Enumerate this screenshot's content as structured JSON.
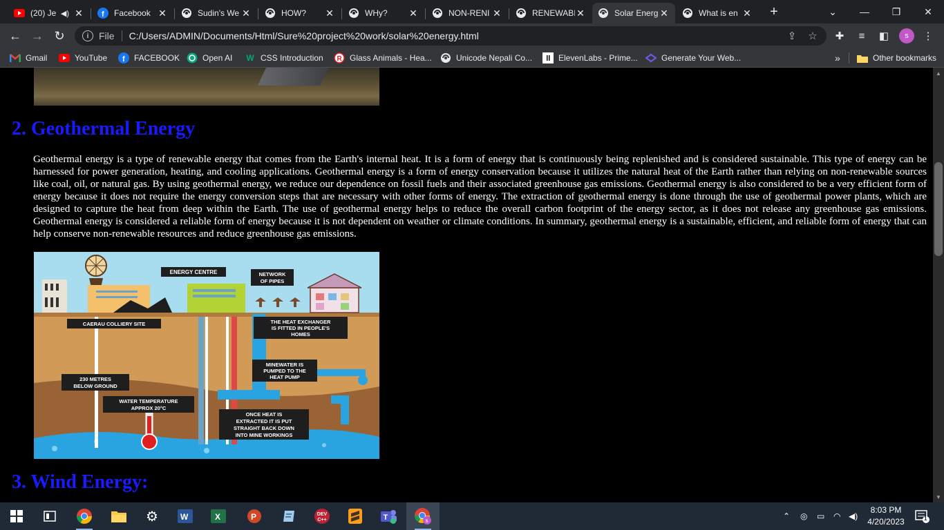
{
  "tabs": [
    {
      "title": "(20) Je",
      "icon": "youtube-icon",
      "audio": true
    },
    {
      "title": "Facebook",
      "icon": "facebook-icon"
    },
    {
      "title": "Sudin's We",
      "icon": "globe-icon"
    },
    {
      "title": "HOW?",
      "icon": "globe-icon"
    },
    {
      "title": "WHy?",
      "icon": "globe-icon"
    },
    {
      "title": "NON-RENI",
      "icon": "globe-icon"
    },
    {
      "title": "RENEWABI",
      "icon": "globe-icon"
    },
    {
      "title": "Solar Energ",
      "icon": "globe-icon",
      "active": true
    },
    {
      "title": "What is en",
      "icon": "globe-icon"
    }
  ],
  "toolbar": {
    "file_label": "File",
    "url": "C:/Users/ADMIN/Documents/Html/Sure%20project%20work/solar%20energy.html",
    "profile_initial": "s"
  },
  "bookmarks": [
    {
      "label": "Gmail",
      "icon": "gmail-icon"
    },
    {
      "label": "YouTube",
      "icon": "youtube-icon"
    },
    {
      "label": "FACEBOOK",
      "icon": "facebook-icon"
    },
    {
      "label": "Open AI",
      "icon": "openai-icon"
    },
    {
      "label": "CSS Introduction",
      "icon": "w3schools-icon"
    },
    {
      "label": "Glass Animals - Hea...",
      "icon": "r-icon"
    },
    {
      "label": "Unicode Nepali Co...",
      "icon": "globe-icon"
    },
    {
      "label": "ElevenLabs - Prime...",
      "icon": "elevenlabs-icon"
    },
    {
      "label": "Generate Your Web...",
      "icon": "diamond-icon"
    }
  ],
  "bookmarks_overflow": "»",
  "other_bookmarks": "Other bookmarks",
  "page": {
    "heading_geo": "2. Geothermal Energy",
    "paragraph_geo": "Geothermal energy is a type of renewable energy that comes from the Earth's internal heat. It is a form of energy that is continuously being replenished and is considered sustainable. This type of energy can be harnessed for power generation, heating, and cooling applications. Geothermal energy is a form of energy conservation because it utilizes the natural heat of the Earth rather than relying on non-renewable sources like coal, oil, or natural gas. By using geothermal energy, we reduce our dependence on fossil fuels and their associated greenhouse gas emissions. Geothermal energy is also considered to be a very efficient form of energy because it does not require the energy conversion steps that are necessary with other forms of energy. The extraction of geothermal energy is done through the use of geothermal power plants, which are designed to capture the heat from deep within the Earth. The use of geothermal energy helps to reduce the overall carbon footprint of the energy sector, as it does not release any greenhouse gas emissions. Geothermal energy is considered a reliable form of energy because it is not dependent on weather or climate conditions. In summary, geothermal energy is a sustainable, efficient, and reliable form of energy that can help conserve non-renewable resources and reduce greenhouse gas emissions.",
    "heading_wind": "3. Wind Energy:",
    "diagram_labels": {
      "energy_centre": "ENERGY CENTRE",
      "network_1": "NETWORK",
      "network_2": "OF PIPES",
      "colliery": "CAERAU COLLIERY SITE",
      "exchanger_1": "THE HEAT EXCHANGER",
      "exchanger_2": "IS FITTED IN PEOPLE'S",
      "exchanger_3": "HOMES",
      "minewater_1": "MINEWATER IS",
      "minewater_2": "PUMPED TO THE",
      "minewater_3": "HEAT PUMP",
      "depth_1": "230 METRES",
      "depth_2": "BELOW GROUND",
      "temp_1": "WATER TEMPERATURE",
      "temp_2": "APPROX 20°C",
      "once_1": "ONCE HEAT IS",
      "once_2": "EXTRACTED IT IS PUT",
      "once_3": "STRAIGHT BACK DOWN",
      "once_4": "INTO MINE WORKINGS"
    }
  },
  "taskbar": {
    "apps": [
      "start-icon",
      "task-view-icon",
      "chrome-icon",
      "file-explorer-icon",
      "settings-icon",
      "word-icon",
      "excel-icon",
      "powerpoint-icon",
      "notepad-icon",
      "dev-cpp-icon",
      "sublime-icon",
      "teams-icon",
      "chrome-profile-icon"
    ],
    "time": "8:03 PM",
    "date": "4/20/2023",
    "notification_count": "1"
  },
  "colors": {
    "heading": "#1a1aff",
    "tab_bar": "#202124",
    "toolbar": "#35363a",
    "taskbar": "#1f2a36"
  }
}
